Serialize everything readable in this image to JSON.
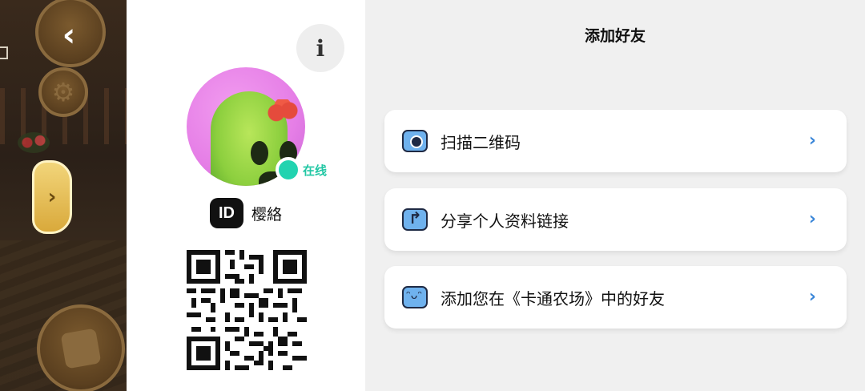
{
  "profile": {
    "status": "在线",
    "id_badge": "ID",
    "username": "樱絡",
    "info_glyph": "i"
  },
  "main": {
    "title": "添加好友",
    "options": [
      {
        "label": "扫描二维码",
        "icon": "camera-icon"
      },
      {
        "label": "分享个人资料链接",
        "icon": "share-icon"
      },
      {
        "label": "添加您在《卡通农场》中的好友",
        "icon": "smile-icon"
      }
    ],
    "chevron": "›"
  },
  "game": {
    "back_glyph": "‹",
    "side_tab_glyph": "›",
    "gear_glyph": "⚙"
  },
  "colors": {
    "accent": "#3a86d8",
    "online": "#22d3b0",
    "panel_bg": "#f0f0f0"
  }
}
